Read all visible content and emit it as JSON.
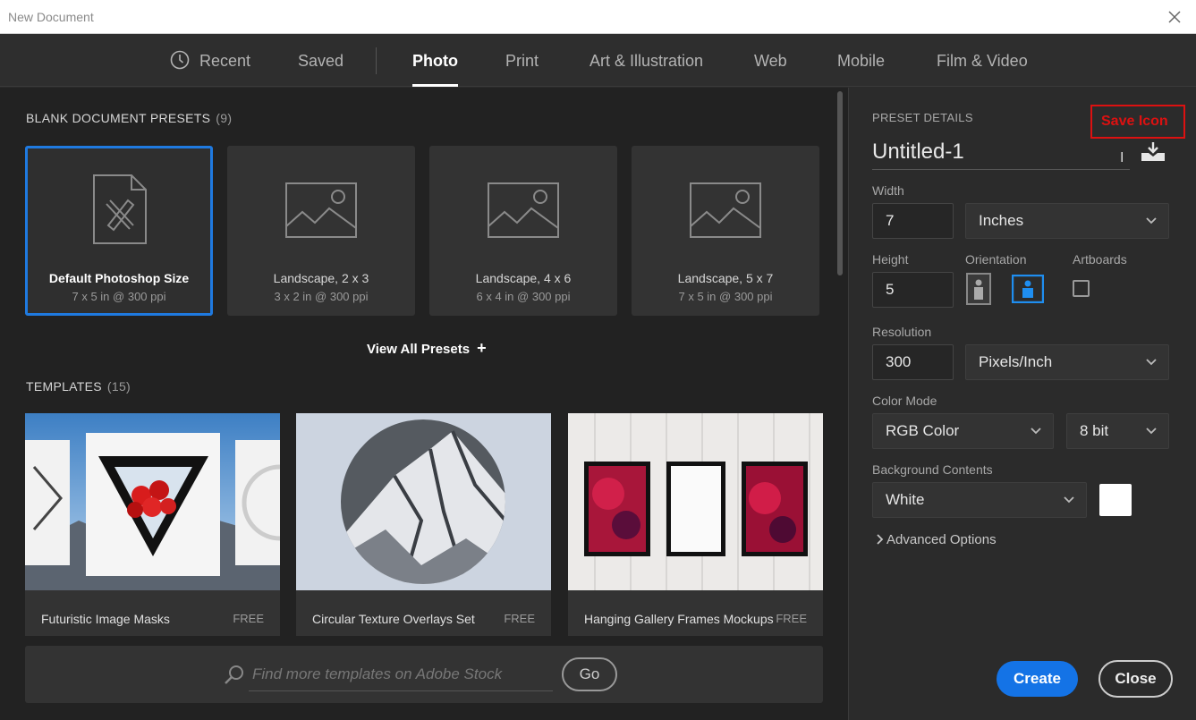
{
  "window": {
    "title": "New Document"
  },
  "tabs": [
    {
      "label": "Recent"
    },
    {
      "label": "Saved"
    },
    {
      "label": "Photo"
    },
    {
      "label": "Print"
    },
    {
      "label": "Art & Illustration"
    },
    {
      "label": "Web"
    },
    {
      "label": "Mobile"
    },
    {
      "label": "Film & Video"
    }
  ],
  "active_tab": "Photo",
  "presets_section": {
    "title": "BLANK DOCUMENT PRESETS",
    "count": "(9)"
  },
  "presets": [
    {
      "name": "Default Photoshop Size",
      "size": "7 x 5 in @ 300 ppi",
      "icon": "document-icon"
    },
    {
      "name": "Landscape, 2 x 3",
      "size": "3 x 2 in @ 300 ppi",
      "icon": "image-icon"
    },
    {
      "name": "Landscape, 4 x 6",
      "size": "6 x 4 in @ 300 ppi",
      "icon": "image-icon"
    },
    {
      "name": "Landscape, 5 x 7",
      "size": "7 x 5 in @ 300 ppi",
      "icon": "image-icon"
    }
  ],
  "view_all": "View All Presets",
  "templates_section": {
    "title": "TEMPLATES",
    "count": "(15)"
  },
  "templates": [
    {
      "name": "Futuristic Image Masks",
      "price": "FREE"
    },
    {
      "name": "Circular Texture Overlays Set",
      "price": "FREE"
    },
    {
      "name": "Hanging Gallery Frames Mockups",
      "price": "FREE"
    }
  ],
  "stock": {
    "placeholder": "Find more templates on Adobe Stock",
    "go": "Go"
  },
  "details": {
    "header": "PRESET DETAILS",
    "annotation": "Save Icon",
    "doc_name": "Untitled-1",
    "width_label": "Width",
    "width": "7",
    "width_unit": "Inches",
    "height_label": "Height",
    "height": "5",
    "orientation_label": "Orientation",
    "artboards_label": "Artboards",
    "resolution_label": "Resolution",
    "resolution": "300",
    "resolution_unit": "Pixels/Inch",
    "color_mode_label": "Color Mode",
    "color_mode": "RGB Color",
    "bit_depth": "8 bit",
    "background_label": "Background Contents",
    "background": "White",
    "advanced": "Advanced Options",
    "create": "Create",
    "close": "Close"
  },
  "colors": {
    "accent": "#1473e6",
    "selected_border": "#1f7ae0",
    "annotation": "#dd1111"
  }
}
